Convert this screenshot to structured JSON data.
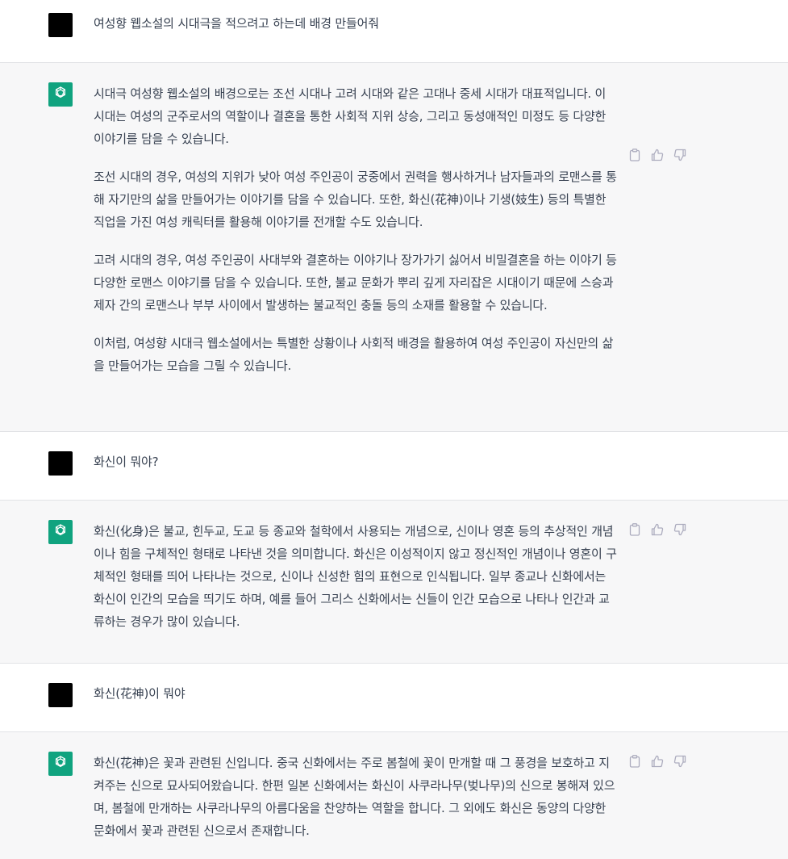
{
  "conversation": [
    {
      "role": "user",
      "text": "여성향 웹소설의 시대극을 적으려고 하는데 배경 만들어줘"
    },
    {
      "role": "assistant",
      "paragraphs": [
        "시대극 여성향 웹소설의 배경으로는 조선 시대나 고려 시대와 같은 고대나 중세 시대가 대표적입니다. 이 시대는 여성의 군주로서의 역할이나 결혼을 통한 사회적 지위 상승, 그리고 동성애적인 미정도 등 다양한 이야기를 담을 수 있습니다.",
        "조선 시대의 경우, 여성의 지위가 낮아 여성 주인공이 궁중에서 권력을 행사하거나 남자들과의 로맨스를 통해 자기만의 삶을 만들어가는 이야기를 담을 수 있습니다. 또한, 화신(花神)이나 기생(妓生) 등의 특별한 직업을 가진 여성 캐릭터를 활용해 이야기를 전개할 수도 있습니다.",
        "고려 시대의 경우, 여성 주인공이 사대부와 결혼하는 이야기나 장가가기 싫어서 비밀결혼을 하는 이야기 등 다양한 로맨스 이야기를 담을 수 있습니다. 또한, 불교 문화가 뿌리 깊게 자리잡은 시대이기 때문에 스승과 제자 간의 로맨스나 부부 사이에서 발생하는 불교적인 충돌 등의 소재를 활용할 수 있습니다.",
        "이처럼, 여성향 시대극 웹소설에서는 특별한 상황이나 사회적 배경을 활용하여 여성 주인공이 자신만의 삶을 만들어가는 모습을 그릴 수 있습니다."
      ]
    },
    {
      "role": "user",
      "text": "화신이 뭐야?"
    },
    {
      "role": "assistant",
      "paragraphs": [
        "화신(化身)은 불교, 힌두교, 도교 등 종교와 철학에서 사용되는 개념으로, 신이나 영혼 등의 추상적인 개념이나 힘을 구체적인 형태로 나타낸 것을 의미합니다. 화신은 이성적이지 않고 정신적인 개념이나 영혼이 구체적인 형태를 띄어 나타나는 것으로, 신이나 신성한 힘의 표현으로 인식됩니다. 일부 종교나 신화에서는 화신이 인간의 모습을 띄기도 하며, 예를 들어 그리스 신화에서는 신들이 인간 모습으로 나타나 인간과 교류하는 경우가 많이 있습니다."
      ]
    },
    {
      "role": "user",
      "text": "화신(花神)이 뭐야"
    },
    {
      "role": "assistant",
      "paragraphs": [
        "화신(花神)은 꽃과 관련된 신입니다. 중국 신화에서는 주로 봄철에 꽃이 만개할 때 그 풍경을 보호하고 지켜주는 신으로 묘사되어왔습니다. 한편 일본 신화에서는 화신이 사쿠라나무(벚나무)의 신으로 봉해져 있으며, 봄철에 만개하는 사쿠라나무의 아름다움을 찬양하는 역할을 합니다. 그 외에도 화신은 동양의 다양한 문화에서 꽃과 관련된 신으로서 존재합니다."
      ]
    }
  ],
  "icons": {
    "copy": "clipboard-icon",
    "like": "thumbs-up-icon",
    "dislike": "thumbs-down-icon",
    "assistant_avatar": "openai-logo-icon"
  },
  "colors": {
    "assistant_avatar_bg": "#10a37f",
    "user_avatar_bg": "#000000",
    "assistant_row_bg": "#f7f7f8",
    "user_row_bg": "#ffffff",
    "text": "#374151",
    "icon": "#acacbe"
  }
}
